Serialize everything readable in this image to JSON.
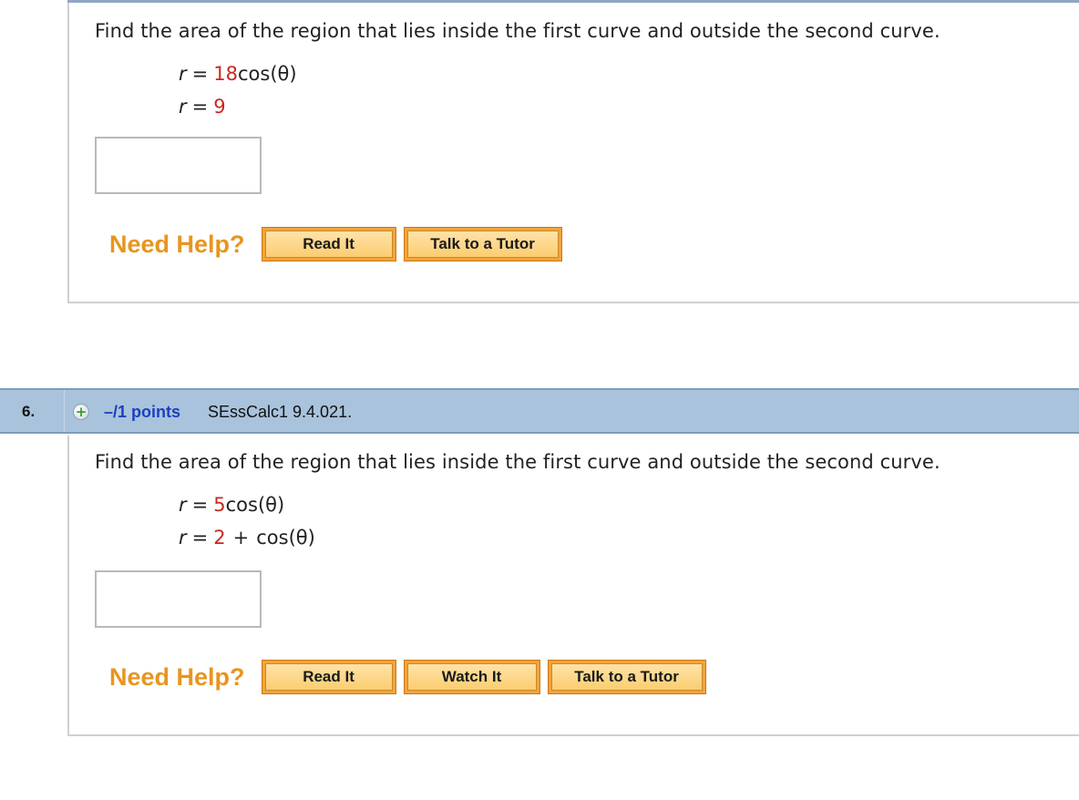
{
  "question5": {
    "prompt": "Find the area of the region that lies inside the first curve and outside the second curve.",
    "eq1": {
      "var": "r",
      "op": "=",
      "value": "18",
      "rest": "cos(θ)"
    },
    "eq2": {
      "var": "r",
      "op": "=",
      "value": "9"
    },
    "answer": "",
    "help": {
      "label": "Need Help?",
      "read_it": "Read It",
      "talk_to_tutor": "Talk to a Tutor"
    }
  },
  "question6": {
    "number": "6.",
    "points": "–/1 points",
    "reference": "SEssCalc1 9.4.021.",
    "prompt": "Find the area of the region that lies inside the first curve and outside the second curve.",
    "eq1": {
      "var": "r",
      "op": "=",
      "value": "5",
      "rest": "cos(θ)"
    },
    "eq2": {
      "var": "r",
      "op": "=",
      "value": "2",
      "plus": "+",
      "rest": "cos(θ)"
    },
    "answer": "",
    "help": {
      "label": "Need Help?",
      "read_it": "Read It",
      "watch_it": "Watch It",
      "talk_to_tutor": "Talk to a Tutor"
    }
  },
  "colors": {
    "header_bar": "#a9c3dc",
    "need_help": "#e8951f",
    "button": "#f3a33a",
    "given_value": "#c8281e",
    "points": "#1d3fbf"
  }
}
